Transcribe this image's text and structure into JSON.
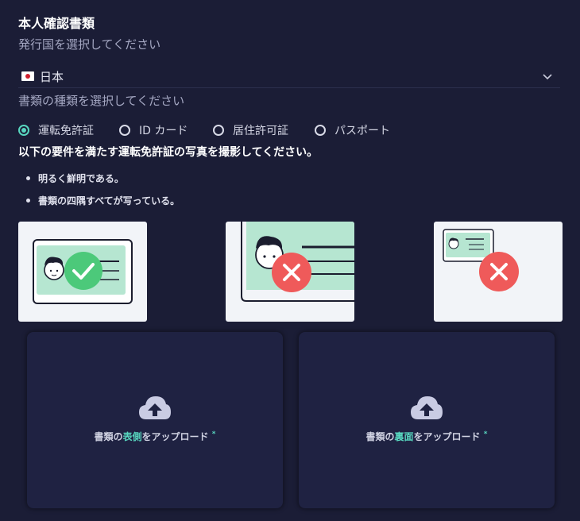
{
  "section": {
    "title": "本人確認書類",
    "country_prompt": "発行国を選択してください",
    "country_value": "日本",
    "doctype_prompt": "書類の種類を選択してください"
  },
  "doc_types": [
    {
      "label": "運転免許証",
      "selected": true
    },
    {
      "label": "ID カード",
      "selected": false
    },
    {
      "label": "居住許可証",
      "selected": false
    },
    {
      "label": "パスポート",
      "selected": false
    }
  ],
  "requirements": {
    "title": "以下の要件を満たす運転免許証の写真を撮影してください。",
    "items": [
      "明るく鮮明である。",
      "書類の四隅すべてが写っている。"
    ]
  },
  "uploads": {
    "front": {
      "prefix": "書類の",
      "highlight": "表側",
      "suffix": "をアップロード",
      "required_mark": "*"
    },
    "back": {
      "prefix": "書類の",
      "highlight": "裏面",
      "suffix": "をアップロード",
      "required_mark": "*"
    }
  },
  "colors": {
    "background": "#1b1d36",
    "accent": "#58d6bf",
    "error": "#ef5a5a",
    "ok": "#4cc97a"
  },
  "icons": {
    "dropdown": "chevron-down-icon",
    "upload": "cloud-upload-icon",
    "ok": "check-circle-icon",
    "bad": "x-circle-icon"
  }
}
